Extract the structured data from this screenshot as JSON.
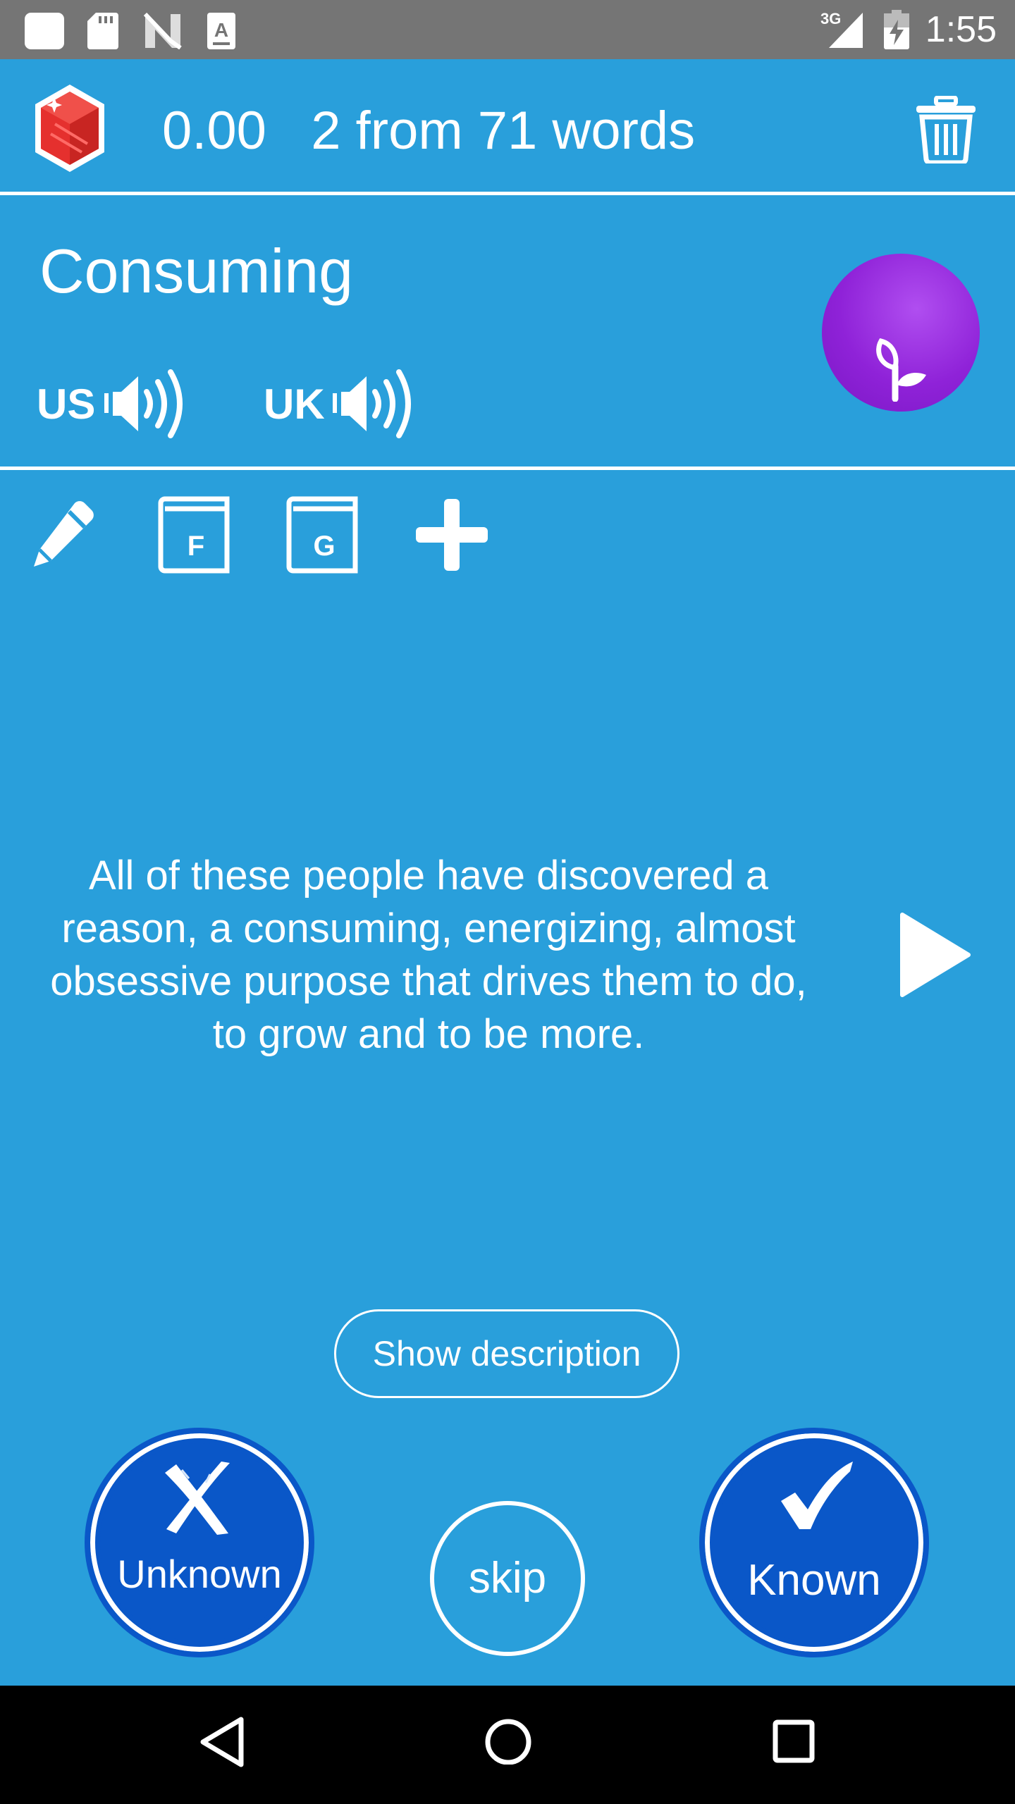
{
  "status_bar": {
    "time": "1:55",
    "network": "3G",
    "icons": [
      "app-square-icon",
      "sd-card-icon",
      "n-logo-icon",
      "a-font-icon",
      "cell-signal-icon",
      "battery-charging-icon"
    ]
  },
  "header": {
    "score": "0.00",
    "progress_text": "2 from 71 words",
    "icons": [
      "ruby-gem-icon",
      "trash-icon"
    ]
  },
  "word": {
    "title": "Consuming",
    "pronunciations": [
      {
        "label": "US",
        "icon": "speaker-icon"
      },
      {
        "label": "UK",
        "icon": "speaker-icon"
      }
    ],
    "badge_icon": "sprout-icon"
  },
  "tools": [
    {
      "icon": "pencil-icon"
    },
    {
      "icon": "book-f-icon",
      "letter": "F"
    },
    {
      "icon": "book-g-icon",
      "letter": "G"
    },
    {
      "icon": "plus-icon"
    }
  ],
  "sentence": "All of these people have discovered a reason, a consuming, energizing, almost obsessive purpose that drives them to do, to grow and to be more.",
  "actions": {
    "show_description": "Show description",
    "unknown": "Unknown",
    "skip": "skip",
    "known": "Known"
  },
  "colors": {
    "background": "#299fdb",
    "status_bar": "#757575",
    "button_blue": "#0a57c8",
    "badge_purple": "#9b2de0",
    "gem_red": "#e5302e"
  },
  "nav_bar": {
    "icons": [
      "back-icon",
      "home-icon",
      "recents-icon"
    ]
  }
}
